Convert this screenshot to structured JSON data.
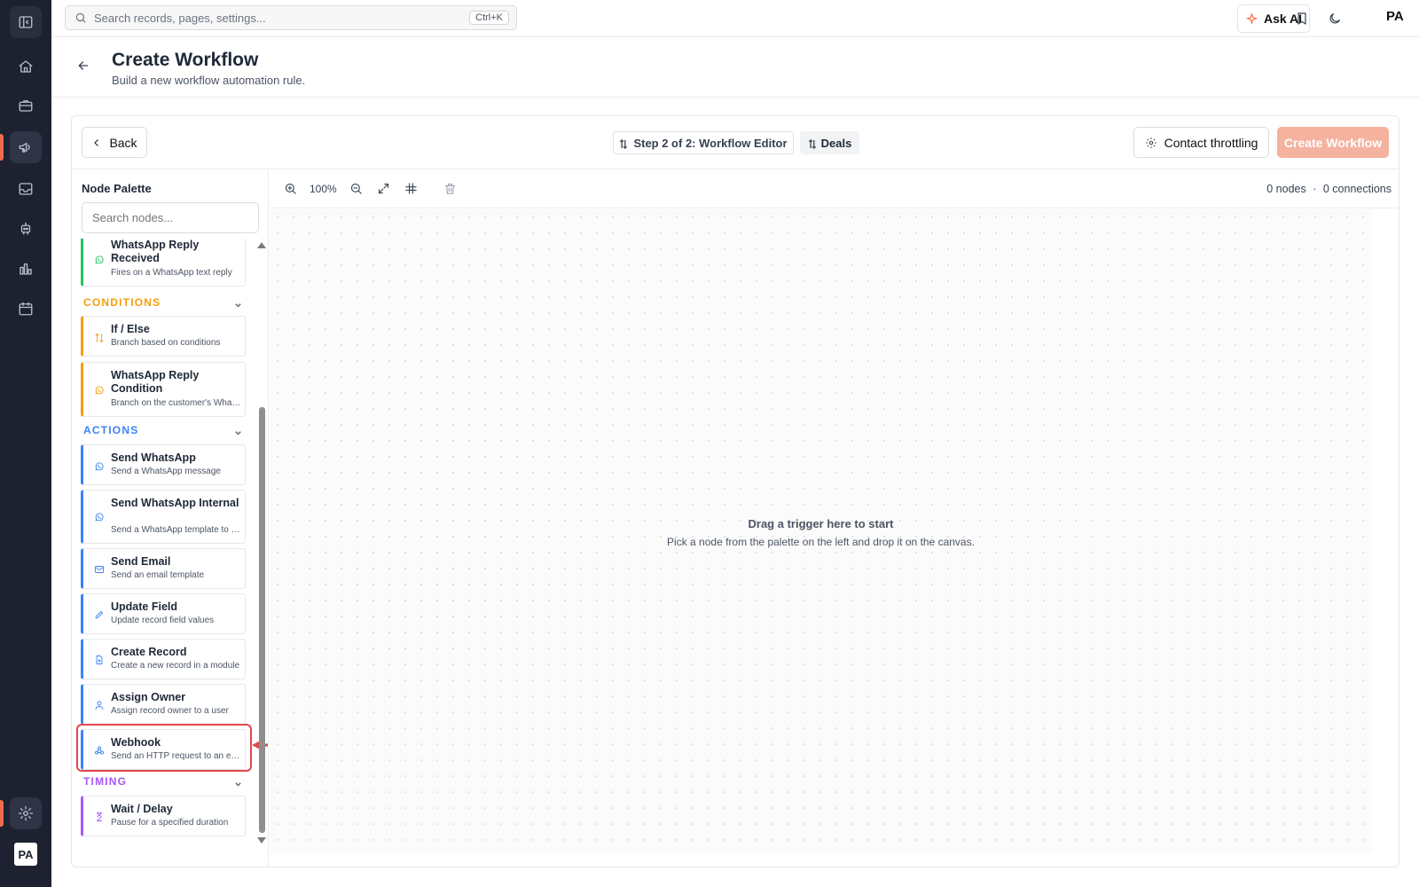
{
  "topbar": {
    "search_placeholder": "Search records, pages, settings...",
    "search_shortcut": "Ctrl+K",
    "ask_ai_label": "Ask AI",
    "avatar": "PA"
  },
  "sidebar": {
    "avatar": "PA",
    "active_item": "campaigns",
    "accent_color": "#ef6c4b"
  },
  "header": {
    "title": "Create Workflow",
    "subtitle": "Build a new workflow automation rule."
  },
  "toolbar": {
    "back_label": "Back",
    "step_label": "Step 2 of 2: Workflow Editor",
    "module_label": "Deals",
    "throttle_label": "Contact throttling",
    "create_label": "Create Workflow"
  },
  "palette": {
    "title": "Node Palette",
    "search_placeholder": "Search nodes...",
    "triggers": [
      {
        "title": "WhatsApp Reply Received",
        "desc": "Fires on a WhatsApp text reply",
        "icon": "whatsapp-icon"
      }
    ],
    "sections": {
      "conditions": "CONDITIONS",
      "actions": "ACTIONS",
      "timing": "TIMING"
    },
    "conditions": [
      {
        "title": "If / Else",
        "desc": "Branch based on conditions",
        "icon": "branch-icon"
      },
      {
        "title": "WhatsApp Reply Condition",
        "desc": "Branch on the customer's WhatsApp reply",
        "icon": "whatsapp-icon"
      }
    ],
    "actions": [
      {
        "title": "Send WhatsApp",
        "desc": "Send a WhatsApp message",
        "icon": "whatsapp-icon"
      },
      {
        "title": "Send WhatsApp Internal",
        "desc": "Send a WhatsApp template to a user",
        "icon": "whatsapp-icon"
      },
      {
        "title": "Send Email",
        "desc": "Send an email template",
        "icon": "mail-icon"
      },
      {
        "title": "Update Field",
        "desc": "Update record field values",
        "icon": "pencil-icon"
      },
      {
        "title": "Create Record",
        "desc": "Create a new record in a module",
        "icon": "file-plus-icon"
      },
      {
        "title": "Assign Owner",
        "desc": "Assign record owner to a user",
        "icon": "user-icon"
      },
      {
        "title": "Webhook",
        "desc": "Send an HTTP request to an endpoint",
        "icon": "webhook-icon"
      }
    ],
    "timing": [
      {
        "title": "Wait / Delay",
        "desc": "Pause for a specified duration",
        "icon": "hourglass-icon"
      }
    ],
    "colors": {
      "trigger": "#22c55e",
      "condition": "#f59e0b",
      "action": "#3b82f6",
      "timing": "#a855f7"
    }
  },
  "canvas": {
    "zoom": "100%",
    "nodes_count": "0 nodes",
    "separator": "·",
    "connections_count": "0 connections",
    "empty_title": "Drag a trigger here to start",
    "empty_subtitle": "Pick a node from the palette on the left and drop it on the canvas."
  },
  "annotation": {
    "highlighted_node": "Webhook",
    "color": "#e0474c"
  }
}
